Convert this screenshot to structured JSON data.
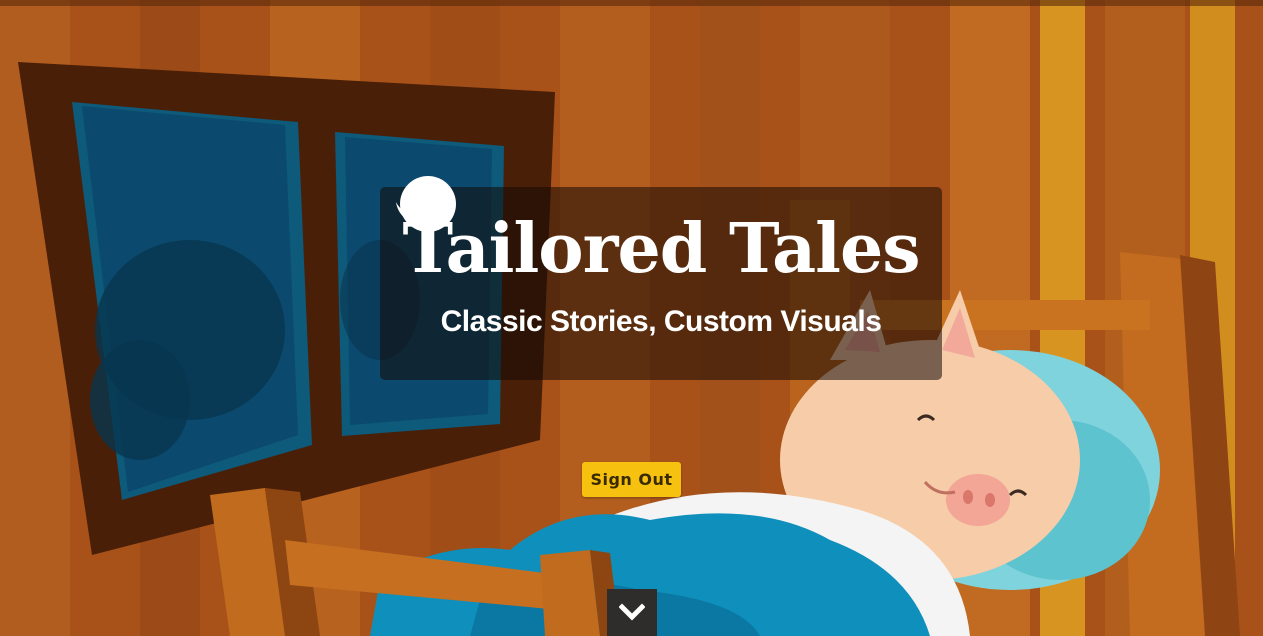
{
  "hero": {
    "title": "Tailored Tales",
    "subtitle": "Classic Stories, Custom Visuals"
  },
  "actions": {
    "sign_out_label": "Sign Out"
  },
  "icons": {
    "moon": "crescent-moon-icon",
    "scroll": "chevron-down-icon"
  },
  "colors": {
    "button_yellow": "#f6c20f",
    "panel_overlay": "rgba(20,10,5,0.55)",
    "scroll_button": "#2e2d2b"
  }
}
